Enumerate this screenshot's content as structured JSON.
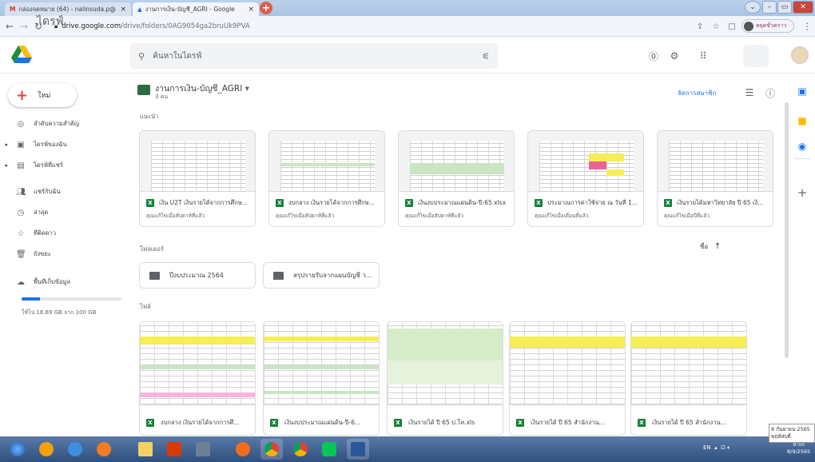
{
  "browser": {
    "tabs": [
      {
        "title": "กล่องจดหมาย (64) - nalinsuda.p@",
        "close": "×"
      },
      {
        "title": "งานการเงิน-บัญชี_AGRI - Google",
        "close": "×"
      }
    ],
    "new_tab": "+",
    "url_host": "drive.google.com",
    "url_path": "/drive/folders/0AG9054ga2bruUk9PVA",
    "profile_label": "หยุดชั่วคราว"
  },
  "app": {
    "name": "ไดรฟ์",
    "search_placeholder": "ค้นหาในไดรฟ์"
  },
  "sidebar": {
    "new_label": "ใหม่",
    "items": [
      {
        "label": "ลำดับความสำคัญ",
        "icon": "priority-icon"
      },
      {
        "label": "ไดรฟ์ของฉัน",
        "icon": "my-drive-icon"
      },
      {
        "label": "ไดรฟ์ที่แชร์",
        "icon": "shared-drives-icon"
      },
      {
        "label": "แชร์กับฉัน",
        "icon": "shared-with-me-icon"
      },
      {
        "label": "ล่าสุด",
        "icon": "clock-icon"
      },
      {
        "label": "ที่ติดดาว",
        "icon": "star-icon"
      },
      {
        "label": "ถังขยะ",
        "icon": "trash-icon"
      },
      {
        "label": "พื้นที่เก็บข้อมูล",
        "icon": "cloud-icon"
      }
    ],
    "storage_text": "ใช้ไป 18.69 GB จาก 100 GB",
    "storage_fraction": 0.187
  },
  "main": {
    "folder_title": "งานการเงิน-บัญชี_AGRI",
    "folder_members": "3 คน",
    "manage_members": "จัดการสมาชิก",
    "suggested_title": "แนะนำ",
    "suggested": [
      {
        "name": "เงิน U2T เงินรายได้จากการศึกษ...",
        "sub": "คุณแก้ไขเมื่อสัปดาห์ที่แล้ว"
      },
      {
        "name": "งบกลาง เงินรายได้จากการศึกษ...",
        "sub": "คุณแก้ไขเมื่อสัปดาห์ที่แล้ว"
      },
      {
        "name": "เงินงบประมาณแผ่นดิน-ปี-65.xlsx",
        "sub": "คุณแก้ไขเมื่อสัปดาห์ที่แล้ว"
      },
      {
        "name": "ประมาณการค่าใช้จ่าย ณ วันที่ 1...",
        "sub": "คุณแก้ไขเมื่อเดือนที่แล้ว"
      },
      {
        "name": "เงินรายได้มหาวิทยาลัย ปี 65 เงิ...",
        "sub": "คุณแก้ไขเมื่อปีที่แล้ว"
      }
    ],
    "folders_title": "โฟลเดอร์",
    "sort_label": "ชื่อ",
    "sort_arrow": "↑",
    "folders": [
      {
        "name": "ปีงบประมาณ 2564"
      },
      {
        "name": "สรุปรายรับจากแผนบัญชี ว..."
      }
    ],
    "files_title": "ไฟล์",
    "files": [
      {
        "name": "งบกลาง เงินรายได้จากการศึ..."
      },
      {
        "name": "เงินงบประมาณแผ่นดิน-ปี-6..."
      },
      {
        "name": "เงินรายได้ ปี 65 ป.โท.xls"
      },
      {
        "name": "เงินรายได้ ปี 65 สำนักงาน..."
      },
      {
        "name": "เงินรายได้ ปี 65 สำนักงาน..."
      }
    ]
  },
  "taskbar": {
    "lang": "EN",
    "time": "9:50",
    "date": "8/9/2565",
    "tooltip_line1": "8 กันยายน 2565",
    "tooltip_line2": "พฤหัสบดี"
  },
  "colors": {
    "accent": "#1a73e8",
    "sheets_green": "#188038"
  }
}
